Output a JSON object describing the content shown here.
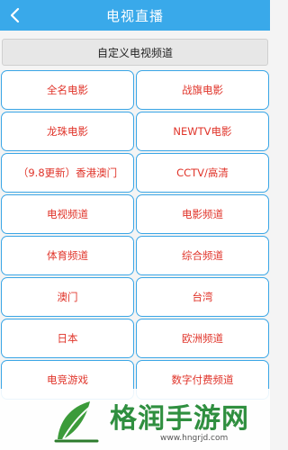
{
  "header": {
    "title": "电视直播",
    "back_icon": "chevron-left-icon"
  },
  "custom_channel": {
    "label": "自定义电视频道"
  },
  "channels": [
    [
      "全名电影",
      "战旗电影"
    ],
    [
      "龙珠电影",
      "NEWTV电影"
    ],
    [
      "（9.8更新）香港澳门",
      "CCTV/高清"
    ],
    [
      "电视频道",
      "电影频道"
    ],
    [
      "体育频道",
      "综合频道"
    ],
    [
      "澳门",
      "台湾"
    ],
    [
      "日本",
      "欧洲频道"
    ],
    [
      "电竞游戏",
      "数字付费频道"
    ]
  ],
  "watermark": {
    "text": "格润手游网",
    "url": "www.hngrjd.com"
  },
  "colors": {
    "header_bg": "#39a9ea",
    "cell_border": "#3aa6e6",
    "cell_text": "#e0342a",
    "watermark_green": "#2f8f3f"
  }
}
